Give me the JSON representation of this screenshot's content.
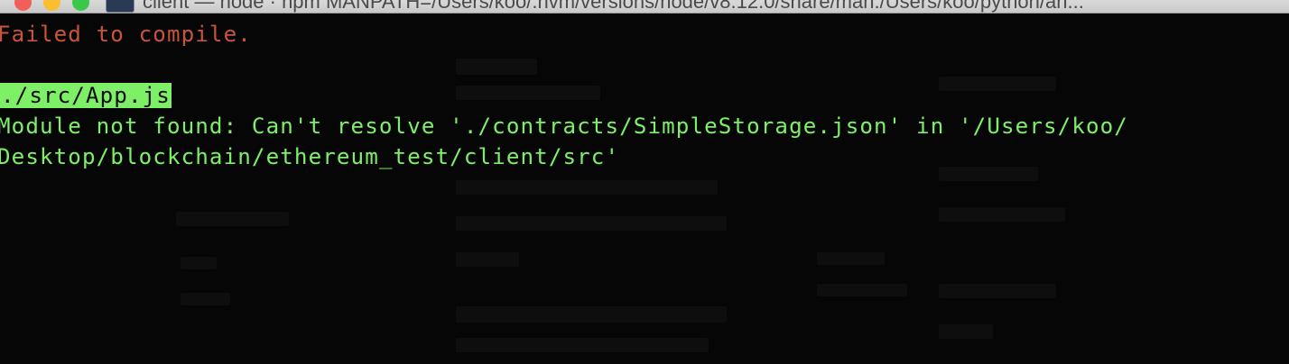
{
  "window": {
    "title": "client — node · npm MANPATH=/Users/koo/.nvm/versions/node/v8.12.0/share/man:/Users/koo/python/an..."
  },
  "terminal": {
    "lines": [
      "Failed to compile.",
      "./src/App.js",
      "Module not found: Can't resolve './contracts/SimpleStorage.json' in '/Users/koo/",
      "Desktop/blockchain/ethereum_test/client/src'"
    ]
  },
  "colors": {
    "error_text": "#c8543e",
    "success_text": "#7ef068",
    "background": "#060606"
  }
}
